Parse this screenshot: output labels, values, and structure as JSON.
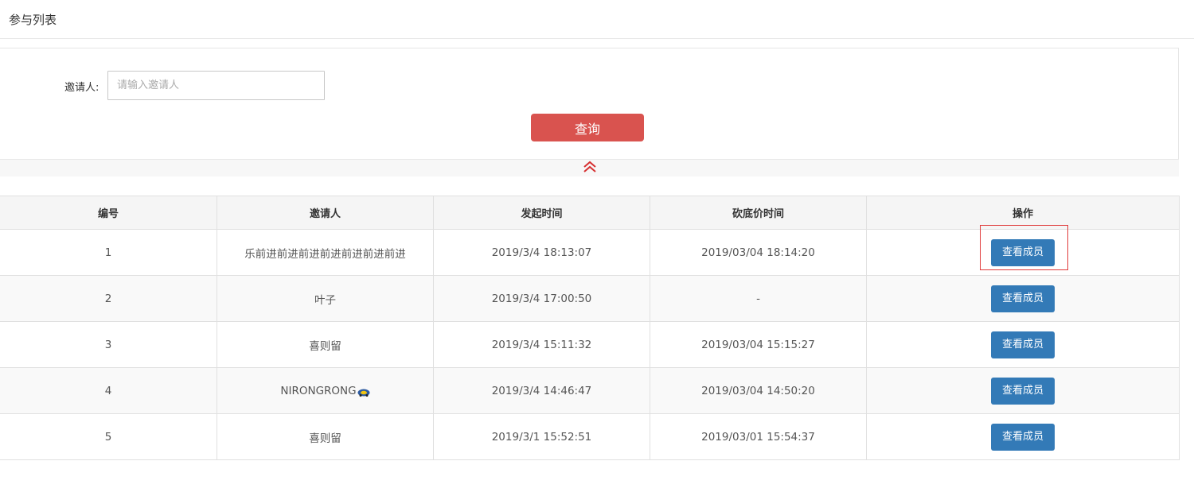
{
  "header": {
    "title": "参与列表"
  },
  "search": {
    "inviter_label": "邀请人:",
    "inviter_placeholder": "请输入邀请人",
    "inviter_value": "",
    "query_button": "查询",
    "collapse_icon": "double-chevron-up-icon"
  },
  "table": {
    "columns": [
      "编号",
      "邀请人",
      "发起时间",
      "砍底价时间",
      "操作"
    ],
    "rows": [
      {
        "id": "1",
        "inviter": "乐前进前进前进前进前进前进前进",
        "start_time": "2019/3/4 18:13:07",
        "floor_time": "2019/03/04 18:14:20",
        "action": "查看成员"
      },
      {
        "id": "2",
        "inviter": "叶子",
        "start_time": "2019/3/4 17:00:50",
        "floor_time": "-",
        "action": "查看成员"
      },
      {
        "id": "3",
        "inviter": "喜则留",
        "start_time": "2019/3/4 15:11:32",
        "floor_time": "2019/03/04 15:15:27",
        "action": "查看成员"
      },
      {
        "id": "4",
        "inviter": "NIRONGRONG",
        "start_time": "2019/3/4 14:46:47",
        "floor_time": "2019/03/04 14:50:20",
        "action": "查看成员"
      },
      {
        "id": "5",
        "inviter": "喜则留",
        "start_time": "2019/3/1 15:52:51",
        "floor_time": "2019/03/01 15:54:37",
        "action": "查看成员"
      }
    ]
  },
  "colors": {
    "query_button": "#d9534f",
    "action_button": "#337ab7",
    "highlight": "#e03a3a",
    "collapse_icon": "#d63031"
  }
}
